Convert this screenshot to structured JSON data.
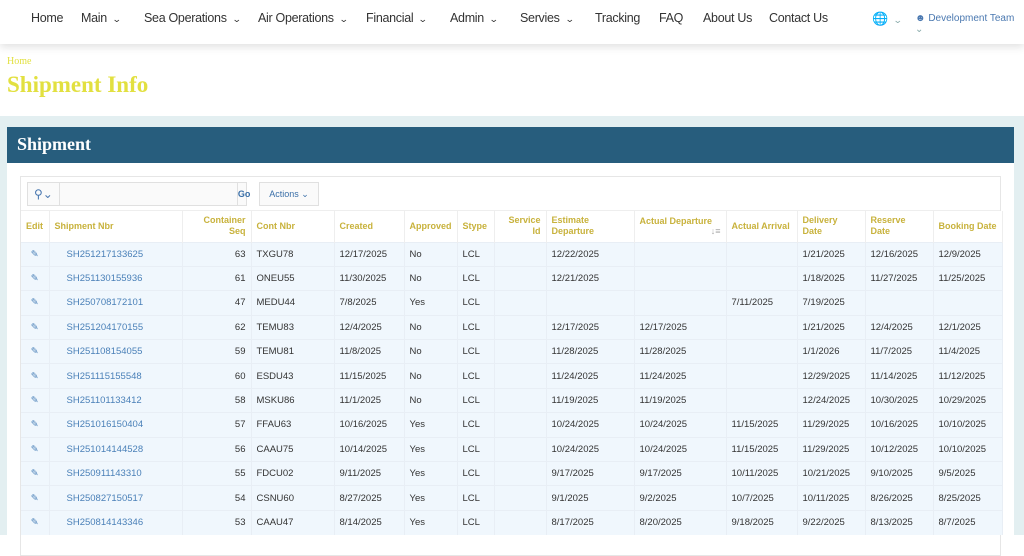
{
  "nav": {
    "items": [
      {
        "label": "Home",
        "dd": false
      },
      {
        "label": "Main",
        "dd": true
      },
      {
        "label": "Sea Operations",
        "dd": true
      },
      {
        "label": "Air Operations",
        "dd": true
      },
      {
        "label": "Financial",
        "dd": true
      },
      {
        "label": "Admin",
        "dd": true
      },
      {
        "label": "Servies",
        "dd": true
      },
      {
        "label": "Tracking",
        "dd": false
      },
      {
        "label": "FAQ",
        "dd": false
      },
      {
        "label": "About Us",
        "dd": false
      },
      {
        "label": "Contact Us",
        "dd": false
      }
    ],
    "user": "Development Team"
  },
  "breadcrumb": "Home",
  "page_title": "Shipment Info",
  "panel_title": "Shipment",
  "toolbar": {
    "go": "Go",
    "actions": "Actions",
    "search_value": ""
  },
  "columns": [
    "Edit",
    "Shipment Nbr",
    "Container Seq",
    "Cont Nbr",
    "Created",
    "Approved",
    "Stype",
    "Service Id",
    "Estimate Departure",
    "Actual Departure",
    "Actual Arrival",
    "Delivery Date",
    "Reserve Date",
    "Booking Date"
  ],
  "rows": [
    [
      "SH251217133625",
      "63",
      "TXGU78",
      "12/17/2025",
      "No",
      "LCL",
      "",
      "12/22/2025",
      "",
      "",
      "1/21/2025",
      "12/16/2025",
      "12/9/2025"
    ],
    [
      "SH251130155936",
      "61",
      "ONEU55",
      "11/30/2025",
      "No",
      "LCL",
      "",
      "12/21/2025",
      "",
      "",
      "1/18/2025",
      "11/27/2025",
      "11/25/2025"
    ],
    [
      "SH250708172101",
      "47",
      "MEDU44",
      "7/8/2025",
      "Yes",
      "LCL",
      "",
      "",
      "",
      "7/11/2025",
      "7/19/2025",
      "",
      ""
    ],
    [
      "SH251204170155",
      "62",
      "TEMU83",
      "12/4/2025",
      "No",
      "LCL",
      "",
      "12/17/2025",
      "12/17/2025",
      "",
      "1/21/2025",
      "12/4/2025",
      "12/1/2025"
    ],
    [
      "SH251108154055",
      "59",
      "TEMU81",
      "11/8/2025",
      "No",
      "LCL",
      "",
      "11/28/2025",
      "11/28/2025",
      "",
      "1/1/2026",
      "11/7/2025",
      "11/4/2025"
    ],
    [
      "SH251115155548",
      "60",
      "ESDU43",
      "11/15/2025",
      "No",
      "LCL",
      "",
      "11/24/2025",
      "11/24/2025",
      "",
      "12/29/2025",
      "11/14/2025",
      "11/12/2025"
    ],
    [
      "SH251101133412",
      "58",
      "MSKU86",
      "11/1/2025",
      "No",
      "LCL",
      "",
      "11/19/2025",
      "11/19/2025",
      "",
      "12/24/2025",
      "10/30/2025",
      "10/29/2025"
    ],
    [
      "SH251016150404",
      "57",
      "FFAU63",
      "10/16/2025",
      "Yes",
      "LCL",
      "",
      "10/24/2025",
      "10/24/2025",
      "11/15/2025",
      "11/29/2025",
      "10/16/2025",
      "10/10/2025"
    ],
    [
      "SH251014144528",
      "56",
      "CAAU75",
      "10/14/2025",
      "Yes",
      "LCL",
      "",
      "10/24/2025",
      "10/24/2025",
      "11/15/2025",
      "11/29/2025",
      "10/12/2025",
      "10/10/2025"
    ],
    [
      "SH250911143310",
      "55",
      "FDCU02",
      "9/11/2025",
      "Yes",
      "LCL",
      "",
      "9/17/2025",
      "9/17/2025",
      "10/11/2025",
      "10/21/2025",
      "9/10/2025",
      "9/5/2025"
    ],
    [
      "SH250827150517",
      "54",
      "CSNU60",
      "8/27/2025",
      "Yes",
      "LCL",
      "",
      "9/1/2025",
      "9/2/2025",
      "10/7/2025",
      "10/11/2025",
      "8/26/2025",
      "8/25/2025"
    ],
    [
      "SH250814143346",
      "53",
      "CAAU47",
      "8/14/2025",
      "Yes",
      "LCL",
      "",
      "8/17/2025",
      "8/20/2025",
      "9/18/2025",
      "9/22/2025",
      "8/13/2025",
      "8/7/2025"
    ]
  ]
}
